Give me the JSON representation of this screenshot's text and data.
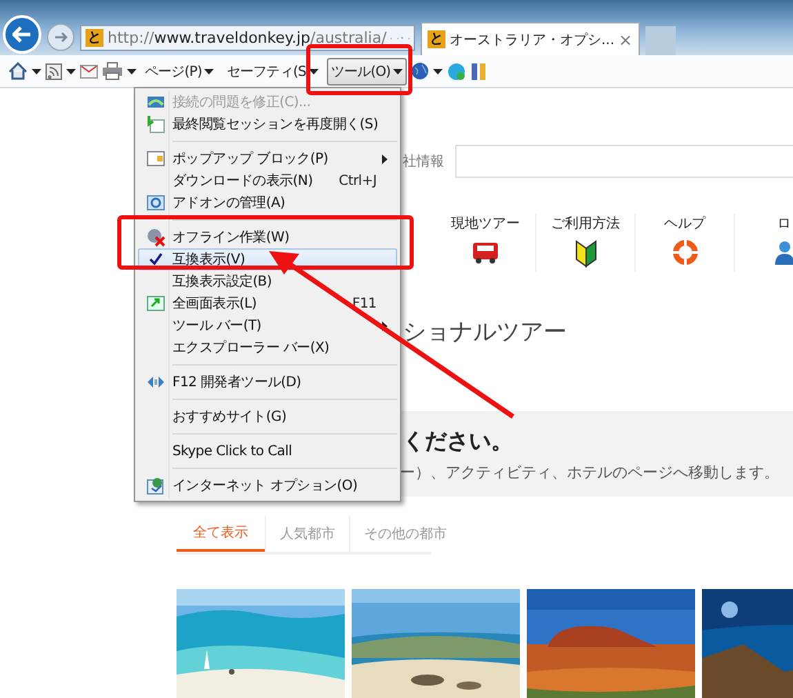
{
  "browser": {
    "favicon": "と",
    "url_prefix": "http://",
    "url_domain": "www.traveldonkey.jp",
    "url_path": "/australia/",
    "tab_favicon": "と",
    "tab_title": "オーストラリア・オプシ...",
    "tab_close": "×"
  },
  "toolbar": {
    "buttons": [
      {
        "label": "ページ(P)",
        "pressed": false
      },
      {
        "label": "セーフティ(S",
        "pressed": false
      },
      {
        "label": "ツール(O)",
        "pressed": true
      }
    ]
  },
  "menu": {
    "groups": [
      {
        "items": [
          {
            "label": "接続の問題を修正(C)...",
            "submenu": false,
            "checked": false,
            "disabled": true,
            "selected": false
          },
          {
            "label": "最終閲覧セッションを再度開く(S)",
            "submenu": false,
            "checked": false,
            "disabled": false,
            "selected": false
          }
        ]
      },
      {
        "items": [
          {
            "label": "ポップアップ ブロック(P)",
            "submenu": true,
            "checked": false,
            "disabled": false,
            "selected": false
          },
          {
            "label": "ダウンロードの表示(N)",
            "shortcut": "Ctrl+J",
            "submenu": false,
            "checked": false,
            "disabled": false,
            "selected": false
          },
          {
            "label": "アドオンの管理(A)",
            "submenu": false,
            "checked": false,
            "disabled": false,
            "selected": false
          }
        ]
      },
      {
        "items": [
          {
            "label": "オフライン作業(W)",
            "submenu": false,
            "checked": false,
            "disabled": false,
            "selected": false
          },
          {
            "label": "互換表示(V)",
            "submenu": false,
            "checked": true,
            "disabled": false,
            "selected": true
          },
          {
            "label": "互換表示設定(B)",
            "submenu": false,
            "checked": false,
            "disabled": false,
            "selected": false
          },
          {
            "label": "全画面表示(L)",
            "shortcut": "F11",
            "submenu": false,
            "checked": false,
            "disabled": false,
            "selected": false
          },
          {
            "label": "ツール バー(T)",
            "submenu": true,
            "checked": false,
            "disabled": false,
            "selected": false
          },
          {
            "label": "エクスプローラー バー(X)",
            "submenu": false,
            "checked": false,
            "disabled": false,
            "selected": false
          }
        ]
      },
      {
        "items": [
          {
            "label": "F12 開発者ツール(D)",
            "submenu": false,
            "checked": false,
            "disabled": false,
            "selected": false
          }
        ]
      },
      {
        "items": [
          {
            "label": "おすすめサイト(G)",
            "submenu": false,
            "checked": false,
            "disabled": false,
            "selected": false
          }
        ]
      },
      {
        "items": [
          {
            "label": "Skype Click to Call",
            "submenu": false,
            "checked": false,
            "disabled": false,
            "selected": false
          }
        ]
      },
      {
        "items": [
          {
            "label": "インターネット オプション(O)",
            "submenu": false,
            "checked": false,
            "disabled": false,
            "selected": false
          }
        ]
      }
    ]
  },
  "page": {
    "search_label": "社情報",
    "nav": [
      {
        "label": "現地ツアー"
      },
      {
        "label": "ご利用方法"
      },
      {
        "label": "ヘルプ"
      },
      {
        "label": "ロ"
      }
    ],
    "heading": "ショナルツアー",
    "banner": {
      "title": "ください。",
      "text": "ー）、アクティビティ、ホテルのページへ移動します。"
    },
    "tabs": [
      {
        "label": "全て表示",
        "selected": true
      },
      {
        "label": "人気都市",
        "selected": false
      },
      {
        "label": "その他の都市",
        "selected": false
      }
    ]
  }
}
